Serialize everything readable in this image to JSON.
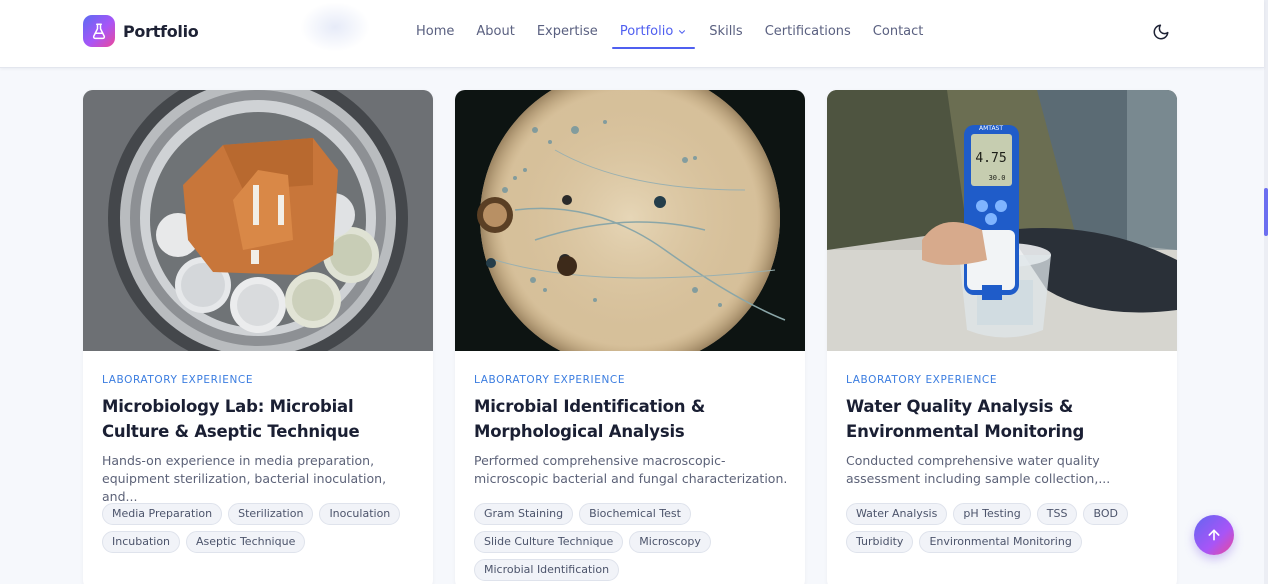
{
  "header": {
    "logo_text": "Portfolio",
    "nav": [
      {
        "label": "Home"
      },
      {
        "label": "About"
      },
      {
        "label": "Expertise"
      },
      {
        "label": "Portfolio",
        "active": true
      },
      {
        "label": "Skills"
      },
      {
        "label": "Certifications"
      },
      {
        "label": "Contact"
      }
    ],
    "accent_color": "#4f5ff0"
  },
  "cards": [
    {
      "category": "LABORATORY EXPERIENCE",
      "title": "Microbiology Lab: Microbial Culture & Aseptic Technique",
      "description": "Hands-on experience in media preparation, equipment sterilization, bacterial inoculation, and...",
      "image": "autoclave-with-petri-dishes",
      "tags": [
        "Media Preparation",
        "Sterilization",
        "Inoculation",
        "Incubation",
        "Aseptic Technique"
      ]
    },
    {
      "category": "LABORATORY EXPERIENCE",
      "title": "Microbial Identification & Morphological Analysis",
      "description": "Performed comprehensive macroscopic-microscopic bacterial and fungal characterization.",
      "image": "microscope-fungal-view",
      "tags": [
        "Gram Staining",
        "Biochemical Test",
        "Slide Culture Technique",
        "Microscopy",
        "Microbial Identification"
      ]
    },
    {
      "category": "LABORATORY EXPERIENCE",
      "title": "Water Quality Analysis & Environmental Monitoring",
      "description": "Conducted comprehensive water quality assessment including sample collection,...",
      "image": "ph-meter-in-water-sample",
      "tags": [
        "Water Analysis",
        "pH Testing",
        "TSS",
        "BOD",
        "Turbidity",
        "Environmental Monitoring"
      ],
      "meter_brand": "AMTAST",
      "meter_reading": "4.75",
      "meter_temp": "30.0"
    }
  ],
  "icons": {
    "logo": "flask-icon",
    "theme": "moon-icon",
    "fab": "arrow-up-icon",
    "nav_dropdown": "chevron-down-icon"
  }
}
